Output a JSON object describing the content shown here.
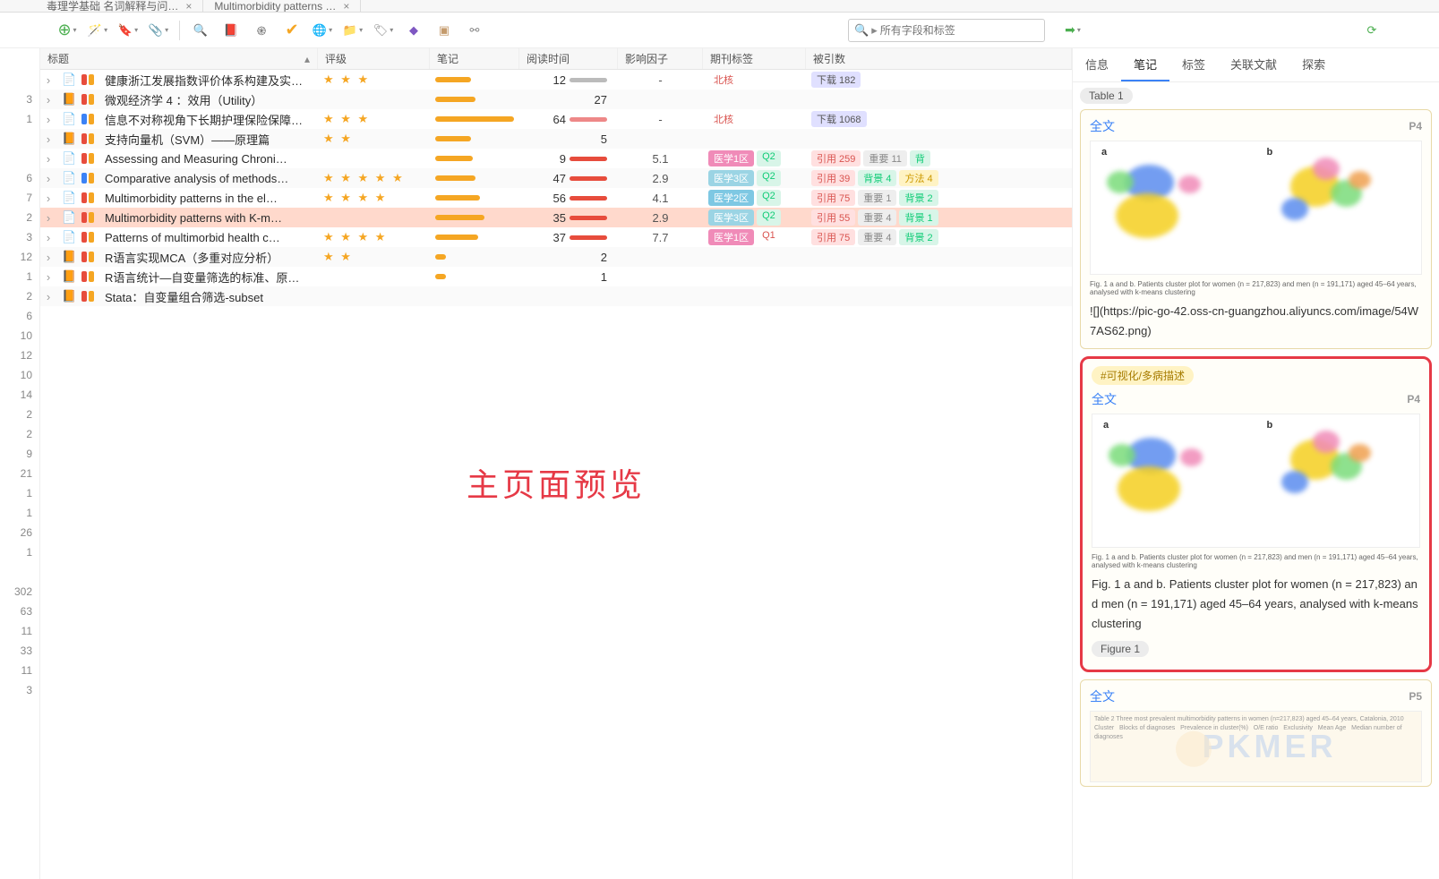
{
  "tabs": [
    {
      "label": "毒理学基础 名词解释与问…"
    },
    {
      "label": "Multimorbidity patterns …"
    }
  ],
  "search": {
    "placeholder": "所有字段和标签"
  },
  "columns": {
    "title": "标题",
    "rating": "评级",
    "note": "笔记",
    "read": "阅读时间",
    "if": "影响因子",
    "jtag": "期刊标签",
    "cite": "被引数"
  },
  "rows": [
    {
      "ind": [
        "#e74c3c",
        "#f5a623"
      ],
      "icon": "📄",
      "title": "健康浙江发展指数评价体系构建及实…",
      "rating": "★ ★ ★",
      "noteW": 40,
      "read": "12",
      "readColor": "#bbb",
      "if": "-",
      "jtag": [
        {
          "t": "北核",
          "c": "#d9534f",
          "bg": "transparent"
        }
      ],
      "cite": [
        {
          "t": "下载 182",
          "c": "#555",
          "bg": "#e0e0ff"
        }
      ]
    },
    {
      "ind": [
        "#e74c3c",
        "#f5a623"
      ],
      "icon": "📙",
      "title": "微观经济学 4 ：效用（Utility）",
      "rating": "",
      "noteW": 45,
      "read": "27",
      "readColor": null,
      "if": "",
      "jtag": [],
      "cite": []
    },
    {
      "ind": [
        "#3b82f6",
        "#f5a623"
      ],
      "icon": "📄",
      "title": "信息不对称视角下长期护理保险保障…",
      "rating": "★ ★ ★",
      "noteW": 95,
      "read": "64",
      "readColor": "#e88",
      "if": "-",
      "jtag": [
        {
          "t": "北核",
          "c": "#d9534f",
          "bg": "transparent"
        }
      ],
      "cite": [
        {
          "t": "下载 1068",
          "c": "#555",
          "bg": "#e0e0ff"
        }
      ]
    },
    {
      "ind": [
        "#e74c3c",
        "#f5a623"
      ],
      "icon": "📙",
      "title": "支持向量机（SVM）——原理篇",
      "rating": "★ ★",
      "noteW": 40,
      "read": "5",
      "readColor": null,
      "if": "",
      "jtag": [],
      "cite": []
    },
    {
      "ind": [
        "#e74c3c",
        "#f5a623"
      ],
      "icon": "📄",
      "title": "Assessing and Measuring Chroni…",
      "rating": "",
      "noteW": 42,
      "read": "9",
      "readColor": "#e74c3c",
      "if": "5.1",
      "jtag": [
        {
          "t": "医学1区",
          "c": "#fff",
          "bg": "#f08bb8"
        },
        {
          "t": "Q2",
          "c": "#1c7",
          "bg": "#d8f5e8"
        }
      ],
      "cite": [
        {
          "t": "引用 259",
          "c": "#d9534f",
          "bg": "#ffe0e0"
        },
        {
          "t": "重要 11",
          "c": "#888",
          "bg": "#eee"
        },
        {
          "t": "背",
          "c": "#1c7",
          "bg": "#d8f5e8"
        }
      ]
    },
    {
      "ind": [
        "#3b82f6",
        "#f5a623"
      ],
      "icon": "📄",
      "title": "Comparative analysis of methods…",
      "rating": "★ ★ ★ ★ ★",
      "noteW": 45,
      "read": "47",
      "readColor": "#e74c3c",
      "if": "2.9",
      "jtag": [
        {
          "t": "医学3区",
          "c": "#fff",
          "bg": "#9bd4e4"
        },
        {
          "t": "Q2",
          "c": "#1c7",
          "bg": "#d8f5e8"
        }
      ],
      "cite": [
        {
          "t": "引用 39",
          "c": "#d9534f",
          "bg": "#ffe0e0"
        },
        {
          "t": "背景 4",
          "c": "#1c7",
          "bg": "#d8f5e8"
        },
        {
          "t": "方法 4",
          "c": "#c90",
          "bg": "#fff3c4"
        }
      ]
    },
    {
      "ind": [
        "#e74c3c",
        "#f5a623"
      ],
      "icon": "📄",
      "title": "Multimorbidity patterns in the el…",
      "rating": "★ ★ ★ ★",
      "noteW": 50,
      "read": "56",
      "readColor": "#e74c3c",
      "if": "4.1",
      "jtag": [
        {
          "t": "医学2区",
          "c": "#fff",
          "bg": "#7ec8e3"
        },
        {
          "t": "Q2",
          "c": "#1c7",
          "bg": "#d8f5e8"
        }
      ],
      "cite": [
        {
          "t": "引用 75",
          "c": "#d9534f",
          "bg": "#ffe0e0"
        },
        {
          "t": "重要 1",
          "c": "#888",
          "bg": "#eee"
        },
        {
          "t": "背景 2",
          "c": "#1c7",
          "bg": "#d8f5e8"
        }
      ]
    },
    {
      "ind": [
        "#e74c3c",
        "#f5a623"
      ],
      "icon": "📄",
      "title": "Multimorbidity patterns with K-m…",
      "rating": "",
      "noteW": 55,
      "read": "35",
      "readColor": "#e74c3c",
      "if": "2.9",
      "jtag": [
        {
          "t": "医学3区",
          "c": "#fff",
          "bg": "#9bd4e4"
        },
        {
          "t": "Q2",
          "c": "#1c7",
          "bg": "#d8f5e8"
        }
      ],
      "cite": [
        {
          "t": "引用 55",
          "c": "#d9534f",
          "bg": "#ffe0e0"
        },
        {
          "t": "重要 4",
          "c": "#888",
          "bg": "#eee"
        },
        {
          "t": "背景 1",
          "c": "#1c7",
          "bg": "#d8f5e8"
        }
      ],
      "sel": true
    },
    {
      "ind": [
        "#e74c3c",
        "#f5a623"
      ],
      "icon": "📄",
      "title": "Patterns of multimorbid health c…",
      "rating": "★ ★ ★ ★",
      "noteW": 48,
      "read": "37",
      "readColor": "#e74c3c",
      "if": "7.7",
      "jtag": [
        {
          "t": "医学1区",
          "c": "#fff",
          "bg": "#f08bb8"
        },
        {
          "t": "Q1",
          "c": "#d9534f",
          "bg": "transparent"
        }
      ],
      "cite": [
        {
          "t": "引用 75",
          "c": "#d9534f",
          "bg": "#ffe0e0"
        },
        {
          "t": "重要 4",
          "c": "#888",
          "bg": "#eee"
        },
        {
          "t": "背景 2",
          "c": "#1c7",
          "bg": "#d8f5e8"
        }
      ]
    },
    {
      "ind": [
        "#e74c3c",
        "#f5a623"
      ],
      "icon": "📙",
      "title": "R语言实现MCA（多重对应分析）",
      "rating": "★ ★",
      "noteW": 12,
      "read": "2",
      "readColor": null,
      "if": "",
      "jtag": [],
      "cite": []
    },
    {
      "ind": [
        "#e74c3c",
        "#f5a623"
      ],
      "icon": "📙",
      "title": "R语言统计—自变量筛选的标准、原…",
      "rating": "",
      "noteW": 12,
      "read": "1",
      "readColor": null,
      "if": "",
      "jtag": [],
      "cite": []
    },
    {
      "ind": [
        "#e74c3c",
        "#f5a623"
      ],
      "icon": "📙",
      "title": "Stata：自变量组合筛选-subset",
      "rating": "",
      "noteW": 0,
      "read": "",
      "readColor": null,
      "if": "",
      "jtag": [],
      "cite": []
    }
  ],
  "gutter": [
    "",
    "3",
    "1",
    "",
    "",
    "6",
    "7",
    "2",
    "3",
    "12",
    "1",
    "2",
    "6",
    "10",
    "12",
    "10",
    "14",
    "2",
    "2",
    "9",
    "21",
    "1",
    "1",
    "26",
    "1",
    "",
    "302",
    "63",
    "11",
    "33",
    "11",
    "3",
    ""
  ],
  "watermark": "主页面预览",
  "rpanel": {
    "tabs": [
      "信息",
      "笔记",
      "标签",
      "关联文献",
      "探索"
    ],
    "active": 1,
    "chip_table": "Table 1",
    "card1": {
      "ft": "全文",
      "pg": "P4",
      "caption_tiny": "Fig. 1 a and b. Patients cluster plot for women (n = 217,823) and men (n = 191,171) aged 45–64 years, analysed with k-means clustering",
      "text": "![](https://pic-go-42.oss-cn-guangzhou.aliyuncs.com/image/54W7AS62.png)"
    },
    "card2": {
      "tag": "#可视化/多病描述",
      "ft": "全文",
      "pg": "P4",
      "caption_tiny": "Fig. 1 a and b. Patients cluster plot for women (n = 217,823) and men (n = 191,171) aged 45–64 years, analysed with k-means clustering",
      "text": "Fig. 1 a and b. Patients cluster plot for women (n = 217,823) and men (n = 191,171) aged 45–64 years, analysed with k-means clustering",
      "chip": "Figure 1"
    },
    "card3": {
      "ft": "全文",
      "pg": "P5",
      "wm": "PKMER"
    }
  }
}
